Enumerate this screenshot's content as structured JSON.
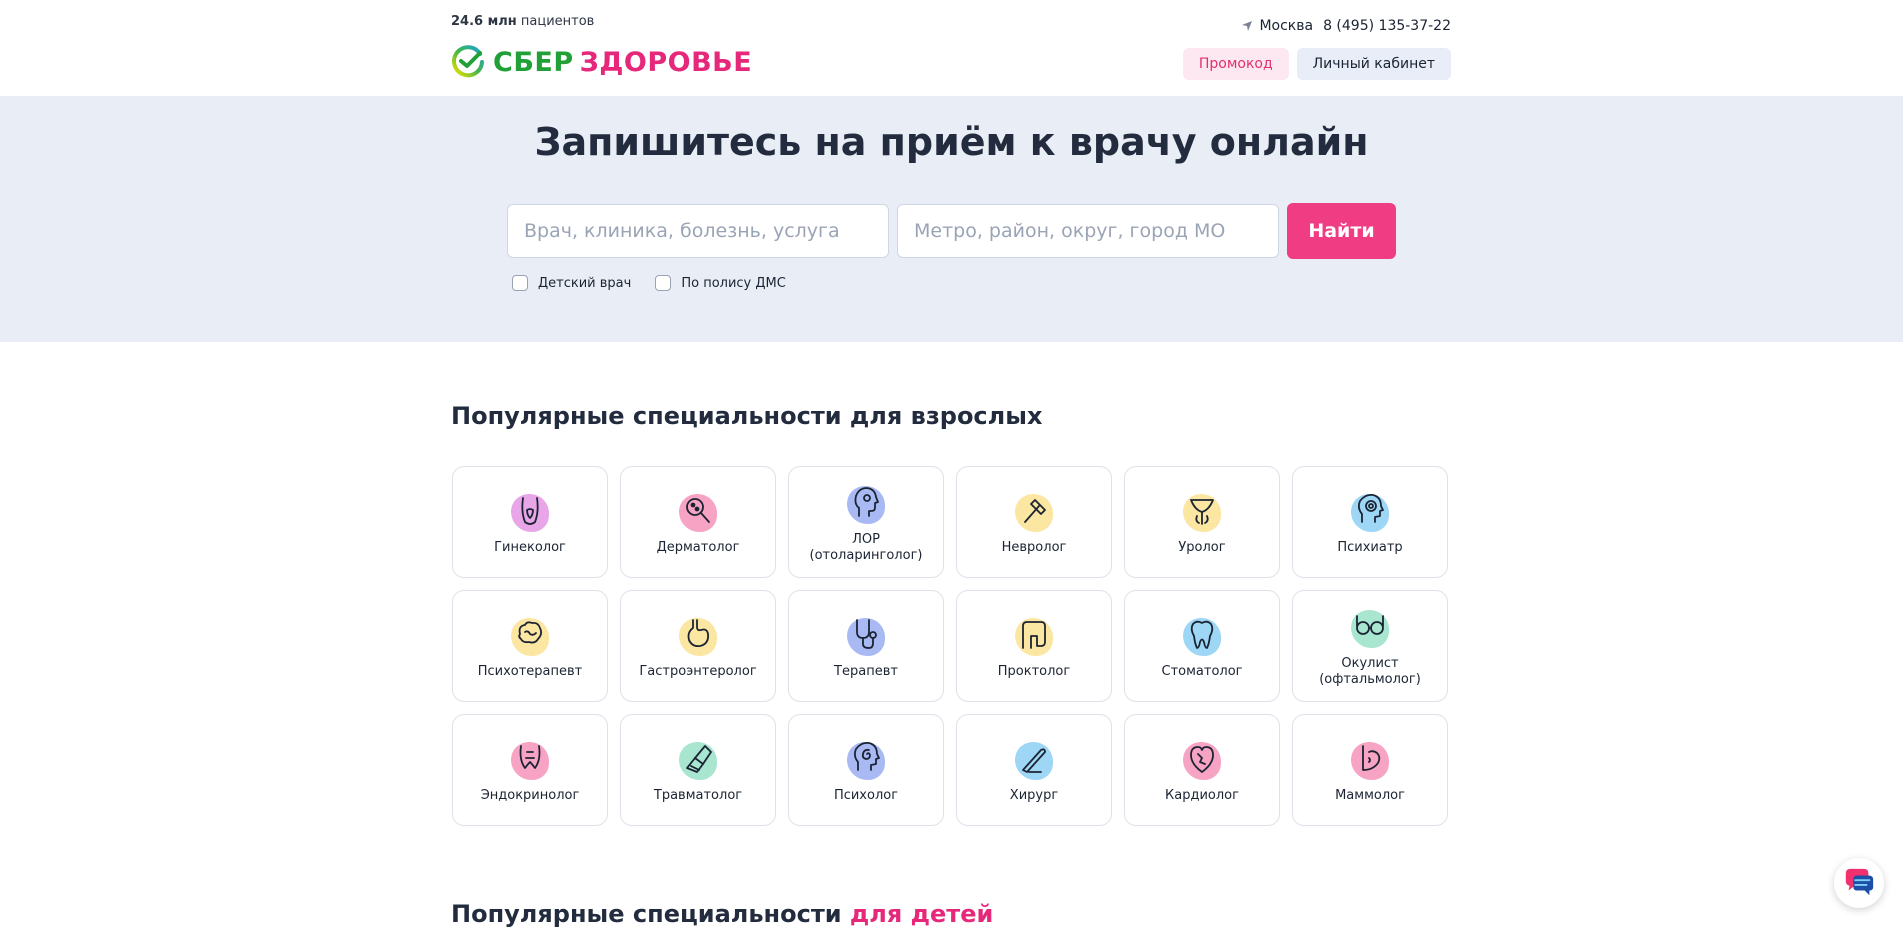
{
  "header": {
    "stats_number": "24.6 млн",
    "stats_label": "пациентов",
    "logo_word1": "СБЕР",
    "logo_word2": "ЗДОРОВЬЕ",
    "city": "Москва",
    "phone": "8 (495) 135-37-22",
    "promo_label": "Промокод",
    "cabinet_label": "Личный кабинет"
  },
  "hero": {
    "title": "Запишитесь на приём к врачу онлайн",
    "search_placeholder": "Врач, клиника, болезнь, услуга",
    "location_placeholder": "Метро, район, округ, город МО",
    "find_label": "Найти",
    "checkbox_child": "Детский врач",
    "checkbox_dms": "По полису ДМС"
  },
  "adults": {
    "title": "Популярные специальности для взрослых",
    "items": [
      {
        "label": "Гинеколог",
        "icon": "gynecology-icon",
        "color": "#e8a6e8"
      },
      {
        "label": "Дерматолог",
        "icon": "dermatology-icon",
        "color": "#f7a3c4"
      },
      {
        "label": "ЛОР\n(отоларинголог)",
        "icon": "ent-icon",
        "color": "#a9b9f3"
      },
      {
        "label": "Невролог",
        "icon": "reflex-hammer-icon",
        "color": "#fbe7a2"
      },
      {
        "label": "Уролог",
        "icon": "urology-icon",
        "color": "#fbe7a2"
      },
      {
        "label": "Психиатр",
        "icon": "psychiatry-icon",
        "color": "#9ed6f5"
      },
      {
        "label": "Психотерапевт",
        "icon": "brain-icon",
        "color": "#fbe7a2"
      },
      {
        "label": "Гастроэнтеролог",
        "icon": "stomach-icon",
        "color": "#fbe7a2"
      },
      {
        "label": "Терапевт",
        "icon": "stethoscope-icon",
        "color": "#a9b9f3"
      },
      {
        "label": "Проктолог",
        "icon": "intestine-icon",
        "color": "#fbe7a2"
      },
      {
        "label": "Стоматолог",
        "icon": "tooth-icon",
        "color": "#9ed6f5"
      },
      {
        "label": "Окулист\n(офтальмолог)",
        "icon": "glasses-icon",
        "color": "#a8e6cf"
      },
      {
        "label": "Эндокринолог",
        "icon": "thyroid-icon",
        "color": "#f7a3c4"
      },
      {
        "label": "Травматолог",
        "icon": "cast-icon",
        "color": "#a8e6cf"
      },
      {
        "label": "Психолог",
        "icon": "spiral-head-icon",
        "color": "#a9b9f3"
      },
      {
        "label": "Хирург",
        "icon": "scalpel-icon",
        "color": "#9ed6f5"
      },
      {
        "label": "Кардиолог",
        "icon": "heart-icon",
        "color": "#f7a3c4"
      },
      {
        "label": "Маммолог",
        "icon": "mammology-icon",
        "color": "#f7a3c4"
      }
    ]
  },
  "kids": {
    "title_prefix": "Популярные специальности ",
    "title_accent": "для детей"
  },
  "colors": {
    "brand_green": "#21a038",
    "brand_pink": "#e5287a",
    "cta": "#ef3c82",
    "hero_bg": "#e9edf5"
  }
}
